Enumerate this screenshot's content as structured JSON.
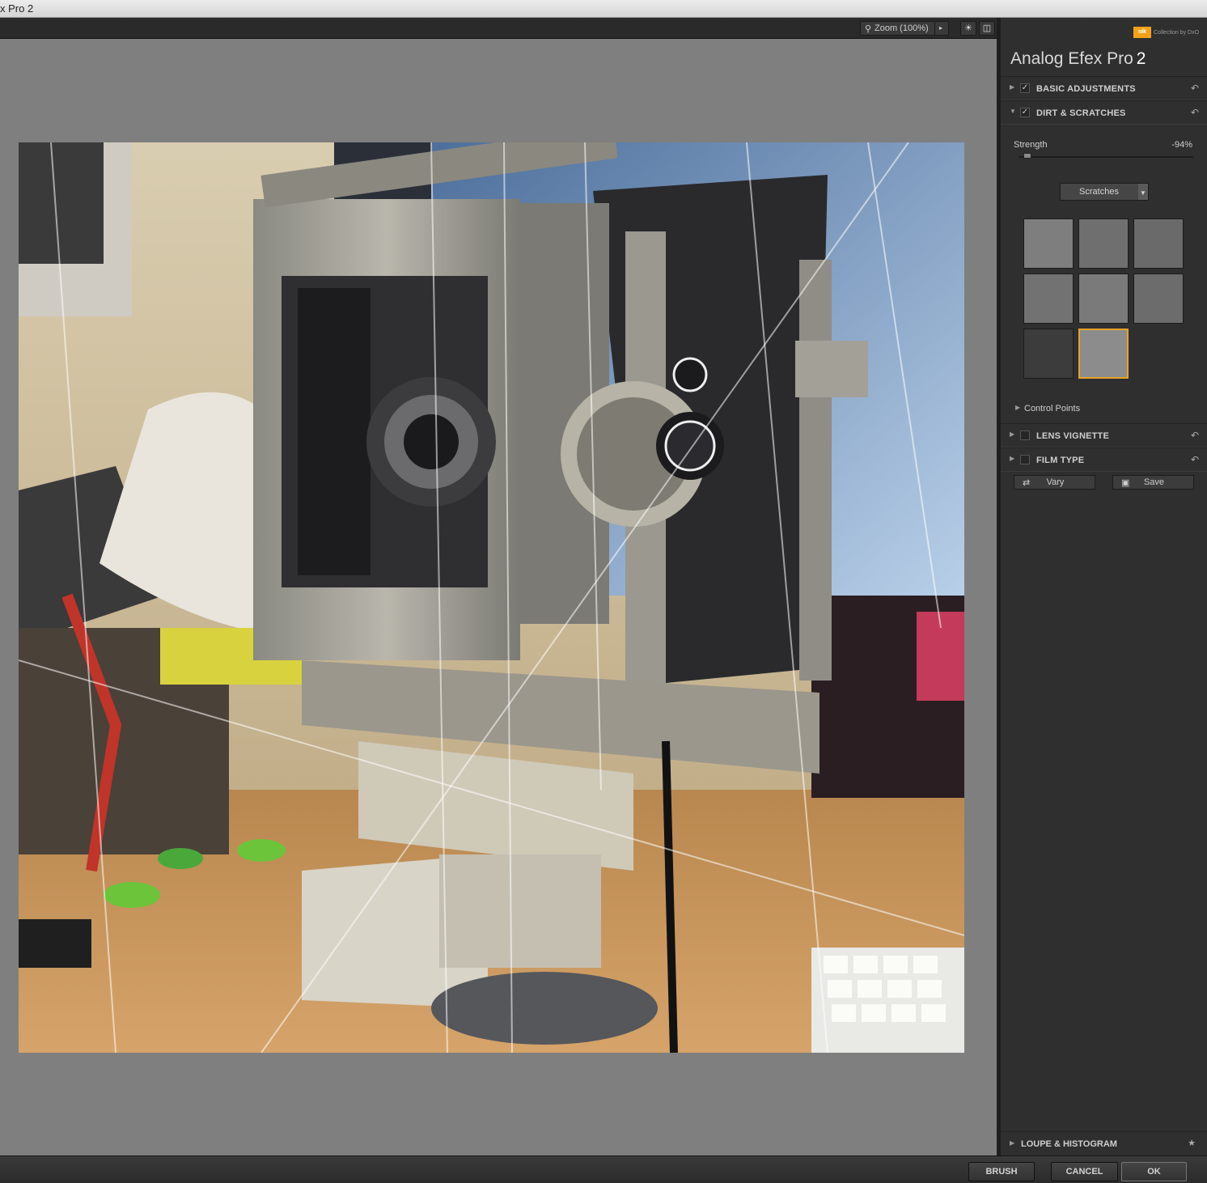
{
  "window": {
    "title": "x Pro 2"
  },
  "toolbar": {
    "zoom_label": "Zoom (100%)",
    "zoom_icon": "magnifier-icon",
    "preview_toggle_icon": "lightbulb-icon",
    "compare_icon": "split-view-icon"
  },
  "branding": {
    "badge": "nik",
    "subtitle": "Collection by DxO"
  },
  "panel": {
    "app_name": "Analog Efex Pro",
    "app_version": "2",
    "sections": {
      "basic_adjustments": {
        "label": "BASIC ADJUSTMENTS",
        "checked": true
      },
      "dirt_scratches": {
        "label": "DIRT & SCRATCHES",
        "checked": true
      },
      "lens_vignette": {
        "label": "LENS VIGNETTE",
        "checked": false
      },
      "film_type": {
        "label": "FILM TYPE",
        "checked": false
      }
    },
    "strength": {
      "label": "Strength",
      "value": "-94%",
      "level": 0.03
    },
    "texture_dropdown": {
      "selected": "Scratches"
    },
    "textures": {
      "count": 8,
      "selected_index": 7
    },
    "control_points": {
      "label": "Control Points"
    },
    "vary_button": {
      "label": "Vary",
      "icon": "shuffle-icon"
    },
    "save_button": {
      "label": "Save",
      "icon": "preset-icon"
    },
    "loupe": {
      "label": "LOUPE & HISTOGRAM"
    }
  },
  "bottom": {
    "brush": "BRUSH",
    "cancel": "CANCEL",
    "ok": "OK"
  },
  "colors": {
    "accent": "#e5a32b",
    "panel_bg": "#2f2f2f",
    "canvas_bg": "#7f7f7f"
  }
}
